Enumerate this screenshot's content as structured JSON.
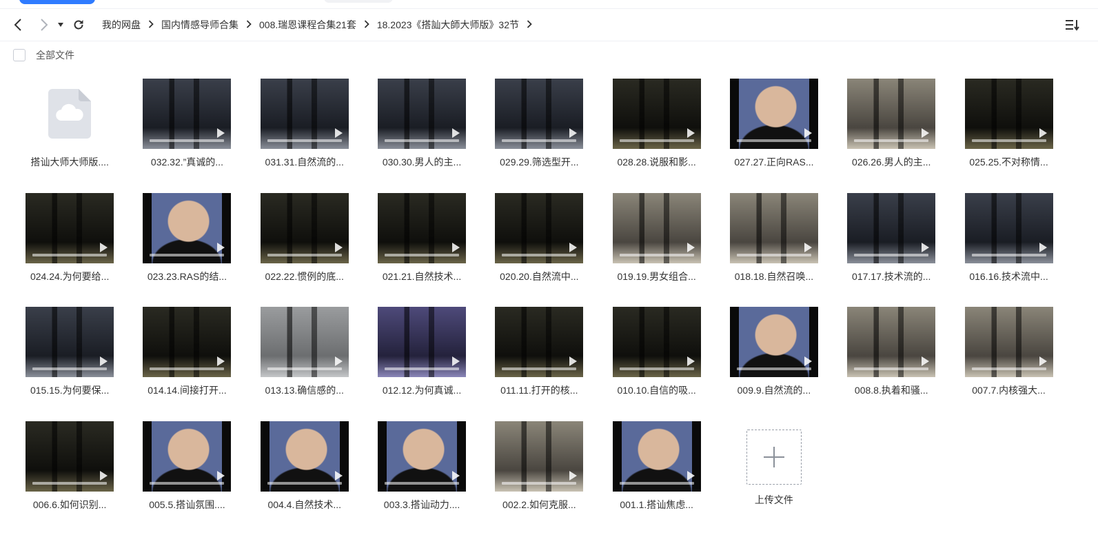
{
  "nav": {
    "back_icon": "chevron-left-icon",
    "forward_icon": "chevron-right-icon",
    "history_icon": "caret-down-icon",
    "refresh_icon": "refresh-icon",
    "sort_icon": "sort-list-icon"
  },
  "breadcrumb": [
    {
      "label": "我的网盘"
    },
    {
      "label": "国内情感导师合集"
    },
    {
      "label": "008.瑞恩课程合集21套"
    },
    {
      "label": "18.2023《搭訕大師大师版》32节"
    }
  ],
  "filter": {
    "select_all_label": "全部文件"
  },
  "files": [
    {
      "name": "搭讪大师大师版....",
      "type": "folder"
    },
    {
      "name": "032.32.”真诚的...",
      "type": "video",
      "scene": "street-night"
    },
    {
      "name": "031.31.自然流的...",
      "type": "video",
      "scene": "street-night"
    },
    {
      "name": "030.30.男人的主...",
      "type": "video",
      "scene": "street-night"
    },
    {
      "name": "029.29.筛选型开...",
      "type": "video",
      "scene": "street-night"
    },
    {
      "name": "028.28.说服和影...",
      "type": "video",
      "scene": "dark"
    },
    {
      "name": "027.27.正向RAS...",
      "type": "video",
      "scene": "studio"
    },
    {
      "name": "026.26.男人的主...",
      "type": "video",
      "scene": "day"
    },
    {
      "name": "025.25.不对称情...",
      "type": "video",
      "scene": "dark"
    },
    {
      "name": "024.24.为何要给...",
      "type": "video",
      "scene": "dark"
    },
    {
      "name": "023.23.RAS的结...",
      "type": "video",
      "scene": "studio"
    },
    {
      "name": "022.22.惯例的底...",
      "type": "video",
      "scene": "dark"
    },
    {
      "name": "021.21.自然技术...",
      "type": "video",
      "scene": "dark"
    },
    {
      "name": "020.20.自然流中...",
      "type": "video",
      "scene": "dark"
    },
    {
      "name": "019.19.男女组合...",
      "type": "video",
      "scene": "day"
    },
    {
      "name": "018.18.自然召唤...",
      "type": "video",
      "scene": "day"
    },
    {
      "name": "017.17.技术流的...",
      "type": "video",
      "scene": "street-night"
    },
    {
      "name": "016.16.技术流中...",
      "type": "video",
      "scene": "street-night"
    },
    {
      "name": "015.15.为何要保...",
      "type": "video",
      "scene": "street-night"
    },
    {
      "name": "014.14.间接打开...",
      "type": "video",
      "scene": "dark"
    },
    {
      "name": "013.13.确信感的...",
      "type": "video",
      "scene": "gray"
    },
    {
      "name": "012.12.为何真诚...",
      "type": "video",
      "scene": "purple"
    },
    {
      "name": "011.11.打开的核...",
      "type": "video",
      "scene": "dark"
    },
    {
      "name": "010.10.自信的吸...",
      "type": "video",
      "scene": "dark"
    },
    {
      "name": "009.9.自然流的...",
      "type": "video",
      "scene": "studio"
    },
    {
      "name": "008.8.执着和骚...",
      "type": "video",
      "scene": "day"
    },
    {
      "name": "007.7.内核强大...",
      "type": "video",
      "scene": "day"
    },
    {
      "name": "006.6.如何识别...",
      "type": "video",
      "scene": "dark"
    },
    {
      "name": "005.5.搭讪氛围....",
      "type": "video",
      "scene": "studio"
    },
    {
      "name": "004.4.自然技术...",
      "type": "video",
      "scene": "studio"
    },
    {
      "name": "003.3.搭讪动力....",
      "type": "video",
      "scene": "studio"
    },
    {
      "name": "002.2.如何克服...",
      "type": "video",
      "scene": "day"
    },
    {
      "name": "001.1.搭讪焦虑...",
      "type": "video",
      "scene": "studio"
    }
  ],
  "upload": {
    "label": "上传文件",
    "icon": "plus-icon"
  },
  "colors": {
    "accent": "#2f7bff",
    "text": "#333333",
    "border": "#eef0f4"
  }
}
